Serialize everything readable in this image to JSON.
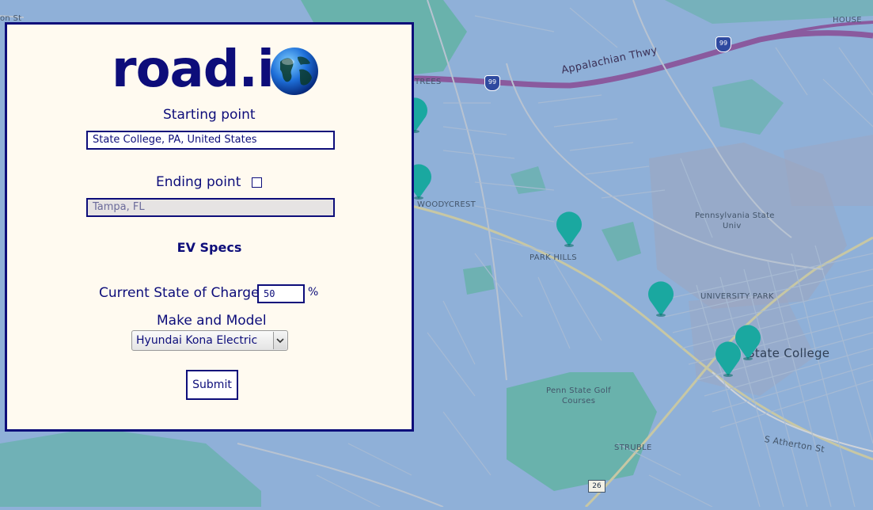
{
  "brand": {
    "logo_text": "road.i",
    "logo_icon": "globe-icon"
  },
  "form": {
    "start_label": "Starting point",
    "start_value": "State College, PA, United States",
    "end_label": "Ending point",
    "end_checked": false,
    "end_placeholder": "Tampa, FL",
    "ev_specs_title": "EV Specs",
    "soc_label": "Current State of Charge",
    "soc_value": "50",
    "soc_unit": "%",
    "make_model_label": "Make and Model",
    "make_model_selected": "Hyundai Kona Electric",
    "submit_label": "Submit"
  },
  "map": {
    "labels": {
      "appalachian": "Appalachian Thwy",
      "trees": "TREES",
      "woodycrest": "WOODYCREST",
      "park_hills": "PARK HILLS",
      "psu_1": "Pennsylvania State",
      "psu_2": "Univ",
      "university_park": "UNIVERSITY PARK",
      "state_college": "State College",
      "golf_1": "Penn State Golf",
      "golf_2": "Courses",
      "struble": "STRUBLE",
      "atherton": "S Atherton St",
      "on_st": "on St",
      "house": "HOUSE"
    },
    "shields": {
      "i99_a": "99",
      "i99_b": "99",
      "route26": "26"
    },
    "marker_color": "#1aa8a0",
    "water_color": "#8fb0d8",
    "park_color": "#58b39a",
    "highway_color": "#8a5a9e"
  }
}
